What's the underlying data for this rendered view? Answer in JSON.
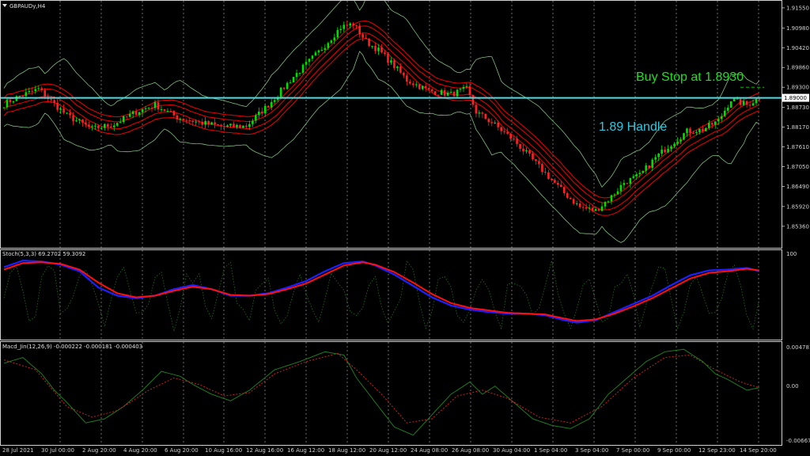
{
  "symbol_label": "GBPAUDy,H4",
  "stoch_label": "Stoch(5,3,3) 69.2702 59.3092",
  "macd_label": "Macd_Jin(12,26,9) -0.000222 -0.000181 -0.000403",
  "annotations": {
    "buy_stop": "Buy Stop at 1.8930",
    "handle": "1.89 Handle"
  },
  "colors": {
    "background": "#000000",
    "frame": "#cfcfcf",
    "bull_candle": "#00e000",
    "bear_candle": "#ff2020",
    "envelope": "#e00000",
    "bollinger": "#7fbf7f",
    "handle_line": "#40e0e8",
    "buy_stop_text": "#22dd22",
    "handle_text": "#30c8e0",
    "stoch_main": "#2020ff",
    "stoch_signal": "#ff1010",
    "macd_main": "#1f7a1f",
    "macd_signal": "#cc2020"
  },
  "chart_data": [
    {
      "type": "candlestick",
      "symbol": "GBPAUDy",
      "timeframe": "H4",
      "ylim": [
        1.8475,
        1.9175
      ],
      "y_ticks": [
        "1.91550",
        "1.90980",
        "1.90420",
        "1.89860",
        "1.89300",
        "1.88730",
        "1.88170",
        "1.87610",
        "1.87050",
        "1.86490",
        "1.85920",
        "1.85360"
      ],
      "y_tick_values": [
        1.9155,
        1.9098,
        1.9042,
        1.8986,
        1.893,
        1.8873,
        1.8817,
        1.8761,
        1.8705,
        1.8649,
        1.8592,
        1.8536
      ],
      "current_price_label": "1.89000",
      "current_price": 1.89,
      "handle_level": 1.89,
      "buy_stop_level": 1.893,
      "x_labels": [
        "28 Jul 2021",
        "30 Jul 00:00",
        "2 Aug 20:00",
        "4 Aug 20:00",
        "6 Aug 20:00",
        "10 Aug 16:00",
        "12 Aug 16:00",
        "16 Aug 12:00",
        "18 Aug 12:00",
        "20 Aug 12:00",
        "24 Aug 08:00",
        "26 Aug 08:00",
        "30 Aug 04:00",
        "1 Sep 04:00",
        "3 Sep 04:00",
        "7 Sep 00:00",
        "9 Sep 00:00",
        "12 Sep 23:00",
        "14 Sep 20:00"
      ],
      "close_path": [
        [
          0,
          1.8882
        ],
        [
          5,
          1.8905
        ],
        [
          11,
          1.8925
        ],
        [
          15,
          1.889
        ],
        [
          20,
          1.885
        ],
        [
          28,
          1.8812
        ],
        [
          35,
          1.8825
        ],
        [
          42,
          1.886
        ],
        [
          48,
          1.888
        ],
        [
          55,
          1.8845
        ],
        [
          62,
          1.883
        ],
        [
          70,
          1.8818
        ],
        [
          77,
          1.882
        ],
        [
          84,
          1.888
        ],
        [
          92,
          1.896
        ],
        [
          100,
          1.903
        ],
        [
          107,
          1.91
        ],
        [
          111,
          1.911
        ],
        [
          115,
          1.906
        ],
        [
          119,
          1.9035
        ],
        [
          124,
          1.899
        ],
        [
          128,
          1.895
        ],
        [
          135,
          1.892
        ],
        [
          142,
          1.891
        ],
        [
          147,
          1.8925
        ],
        [
          150,
          1.886
        ],
        [
          155,
          1.883
        ],
        [
          162,
          1.878
        ],
        [
          170,
          1.8705
        ],
        [
          178,
          1.863
        ],
        [
          183,
          1.859
        ],
        [
          188,
          1.858
        ],
        [
          193,
          1.862
        ],
        [
          197,
          1.866
        ],
        [
          202,
          1.868
        ],
        [
          207,
          1.873
        ],
        [
          212,
          1.877
        ],
        [
          217,
          1.8805
        ],
        [
          222,
          1.881
        ],
        [
          227,
          1.8835
        ],
        [
          231,
          1.8895
        ],
        [
          236,
          1.888
        ],
        [
          240,
          1.89
        ]
      ]
    },
    {
      "type": "line",
      "name": "Stoch(5,3,3)",
      "main_value": 69.2702,
      "signal_value": 59.3092,
      "ylim": [
        0,
        100
      ],
      "y_ticks": [
        "100"
      ],
      "main": [
        [
          0,
          85
        ],
        [
          6,
          93
        ],
        [
          12,
          92
        ],
        [
          18,
          88
        ],
        [
          24,
          80
        ],
        [
          30,
          60
        ],
        [
          36,
          50
        ],
        [
          42,
          47
        ],
        [
          48,
          50
        ],
        [
          54,
          58
        ],
        [
          60,
          63
        ],
        [
          66,
          58
        ],
        [
          72,
          50
        ],
        [
          78,
          50
        ],
        [
          84,
          53
        ],
        [
          90,
          60
        ],
        [
          96,
          68
        ],
        [
          102,
          80
        ],
        [
          108,
          90
        ],
        [
          114,
          92
        ],
        [
          118,
          87
        ],
        [
          124,
          76
        ],
        [
          130,
          62
        ],
        [
          136,
          48
        ],
        [
          142,
          38
        ],
        [
          148,
          33
        ],
        [
          154,
          30
        ],
        [
          160,
          28
        ],
        [
          166,
          28
        ],
        [
          172,
          26
        ],
        [
          178,
          20
        ],
        [
          182,
          17
        ],
        [
          188,
          20
        ],
        [
          194,
          30
        ],
        [
          200,
          40
        ],
        [
          206,
          50
        ],
        [
          212,
          63
        ],
        [
          218,
          75
        ],
        [
          224,
          81
        ],
        [
          230,
          82
        ],
        [
          236,
          84
        ],
        [
          240,
          80
        ]
      ],
      "signal": [
        [
          0,
          82
        ],
        [
          6,
          90
        ],
        [
          12,
          91
        ],
        [
          18,
          89
        ],
        [
          24,
          82
        ],
        [
          30,
          66
        ],
        [
          36,
          53
        ],
        [
          42,
          48
        ],
        [
          48,
          50
        ],
        [
          54,
          56
        ],
        [
          60,
          61
        ],
        [
          66,
          58
        ],
        [
          72,
          51
        ],
        [
          78,
          50
        ],
        [
          84,
          52
        ],
        [
          90,
          58
        ],
        [
          96,
          65
        ],
        [
          102,
          76
        ],
        [
          108,
          87
        ],
        [
          114,
          91
        ],
        [
          118,
          88
        ],
        [
          124,
          79
        ],
        [
          130,
          66
        ],
        [
          136,
          52
        ],
        [
          142,
          41
        ],
        [
          148,
          35
        ],
        [
          154,
          32
        ],
        [
          160,
          29
        ],
        [
          166,
          28
        ],
        [
          172,
          27
        ],
        [
          178,
          22
        ],
        [
          182,
          19
        ],
        [
          188,
          21
        ],
        [
          194,
          28
        ],
        [
          200,
          37
        ],
        [
          206,
          47
        ],
        [
          212,
          59
        ],
        [
          218,
          71
        ],
        [
          224,
          78
        ],
        [
          230,
          80
        ],
        [
          236,
          83
        ],
        [
          240,
          81
        ]
      ]
    },
    {
      "type": "line",
      "name": "Macd_Jin(12,26,9)",
      "main_value": -0.000222,
      "signal_value": -0.000181,
      "histogram_value": -0.000403,
      "ylim": [
        -0.007,
        0.0052
      ],
      "y_ticks": [
        "0.004781",
        "0.00",
        "-0.006672"
      ],
      "y_tick_values": [
        0.004781,
        0,
        -0.006672
      ],
      "main": [
        [
          0,
          0.0028
        ],
        [
          6,
          0.0035
        ],
        [
          12,
          0.0015
        ],
        [
          16,
          -0.0005
        ],
        [
          20,
          -0.002
        ],
        [
          26,
          -0.0045
        ],
        [
          32,
          -0.004
        ],
        [
          38,
          -0.0025
        ],
        [
          44,
          -0.0005
        ],
        [
          50,
          0.0018
        ],
        [
          56,
          0.0012
        ],
        [
          60,
          0.0002
        ],
        [
          66,
          -0.001
        ],
        [
          72,
          -0.0018
        ],
        [
          78,
          -0.0005
        ],
        [
          86,
          0.002
        ],
        [
          94,
          0.003
        ],
        [
          102,
          0.0042
        ],
        [
          108,
          0.0038
        ],
        [
          112,
          0.001
        ],
        [
          118,
          -0.002
        ],
        [
          124,
          -0.005
        ],
        [
          130,
          -0.006
        ],
        [
          136,
          -0.0035
        ],
        [
          142,
          -0.001
        ],
        [
          148,
          0.0005
        ],
        [
          152,
          -0.001
        ],
        [
          156,
          0.0
        ],
        [
          162,
          -0.002
        ],
        [
          168,
          -0.004
        ],
        [
          174,
          -0.0048
        ],
        [
          180,
          -0.0052
        ],
        [
          186,
          -0.004
        ],
        [
          192,
          -0.001
        ],
        [
          198,
          0.001
        ],
        [
          204,
          0.003
        ],
        [
          210,
          0.0042
        ],
        [
          216,
          0.0045
        ],
        [
          222,
          0.003
        ],
        [
          226,
          0.0015
        ],
        [
          230,
          0.0008
        ],
        [
          236,
          -0.0005
        ],
        [
          240,
          -0.0002
        ]
      ],
      "signal": [
        [
          0,
          0.0032
        ],
        [
          10,
          0.002
        ],
        [
          20,
          -0.0025
        ],
        [
          28,
          -0.0038
        ],
        [
          36,
          -0.003
        ],
        [
          46,
          -0.0005
        ],
        [
          54,
          0.001
        ],
        [
          62,
          0.0002
        ],
        [
          70,
          -0.0012
        ],
        [
          78,
          -0.0008
        ],
        [
          86,
          0.0015
        ],
        [
          96,
          0.003
        ],
        [
          106,
          0.004
        ],
        [
          112,
          0.002
        ],
        [
          120,
          -0.001
        ],
        [
          128,
          -0.0045
        ],
        [
          136,
          -0.004
        ],
        [
          144,
          -0.0012
        ],
        [
          152,
          -0.0005
        ],
        [
          160,
          -0.0015
        ],
        [
          170,
          -0.0038
        ],
        [
          180,
          -0.0045
        ],
        [
          190,
          -0.0025
        ],
        [
          200,
          0.001
        ],
        [
          210,
          0.0035
        ],
        [
          218,
          0.0038
        ],
        [
          226,
          0.002
        ],
        [
          234,
          0.0005
        ],
        [
          240,
          -0.0002
        ]
      ]
    }
  ]
}
